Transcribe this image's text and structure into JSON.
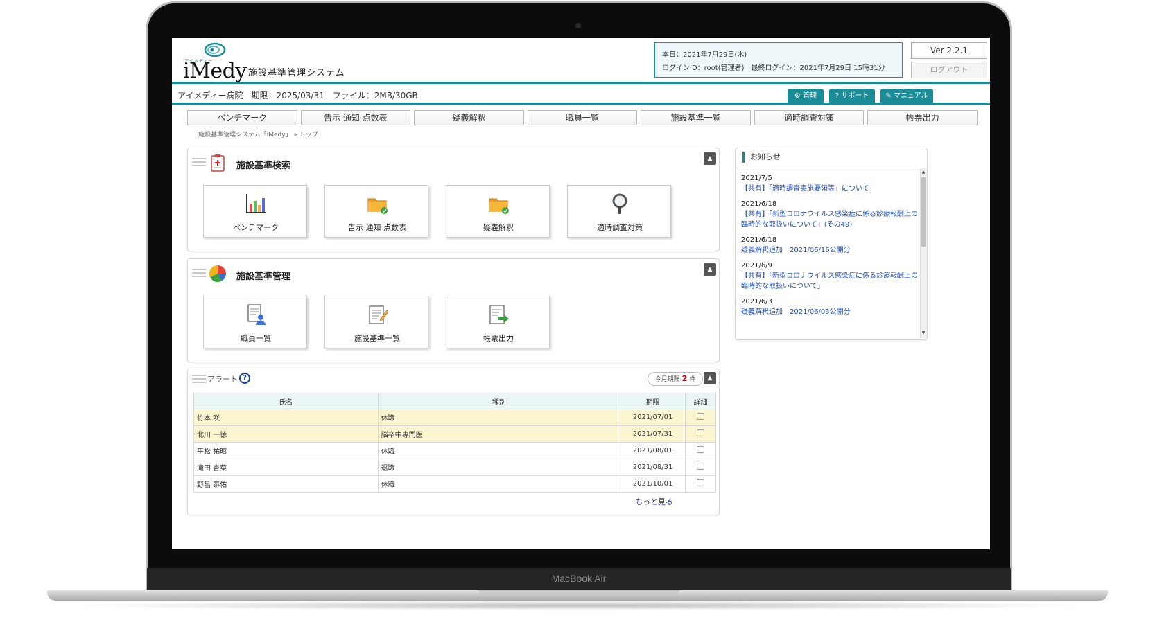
{
  "device": {
    "brand_label": "MacBook Air"
  },
  "header": {
    "logo_ruby": "アイメディー",
    "logo": "iMedy",
    "app_title": "施設基準管理システム",
    "login_date": "本日：2021年7月29日(木)",
    "login_info": "ログインID：root(管理者)　最終ログイン：2021年7月29日 15時31分",
    "version": "Ver 2.2.1",
    "logout": "ログアウト"
  },
  "subbar": {
    "info": "アイメディー病院　期限：2025/03/31　ファイル：2MB/30GB",
    "admin": "管理",
    "support": "サポート",
    "manual": "マニュアル"
  },
  "nav": [
    "ベンチマーク",
    "告示 通知 点数表",
    "疑義解釈",
    "職員一覧",
    "施設基準一覧",
    "適時調査対策",
    "帳票出力"
  ],
  "breadcrumb": "施設基準管理システム「iMedy」 » トップ",
  "search_panel": {
    "title": "施設基準検索",
    "tiles": [
      "ベンチマーク",
      "告示 通知 点数表",
      "疑義解釈",
      "適時調査対策"
    ]
  },
  "manage_panel": {
    "title": "施設基準管理",
    "tiles": [
      "職員一覧",
      "施設基準一覧",
      "帳票出力"
    ]
  },
  "alert_panel": {
    "title": "アラート",
    "help": "?",
    "badge_label": "今月期限",
    "badge_count": "2",
    "badge_unit": "件",
    "columns": [
      "氏名",
      "種別",
      "期限",
      "詳細"
    ],
    "rows": [
      {
        "name": "竹本 咲",
        "type": "休職",
        "due": "2021/07/01"
      },
      {
        "name": "北川 一徳",
        "type": "脳卒中専門医",
        "due": "2021/07/31"
      },
      {
        "name": "平松 祐昭",
        "type": "休職",
        "due": "2021/08/01"
      },
      {
        "name": "滝田 杏菜",
        "type": "退職",
        "due": "2021/08/31"
      },
      {
        "name": "野呂 泰佑",
        "type": "休職",
        "due": "2021/10/01"
      }
    ],
    "more": "もっと見る"
  },
  "news": {
    "title": "お知らせ",
    "items": [
      {
        "date": "2021/7/5",
        "text": "【共有】「適時調査実施要領等」について"
      },
      {
        "date": "2021/6/18",
        "text": "【共有】「新型コロナウイルス感染症に係る診療報酬上の臨時的な取扱いについて」(その49)"
      },
      {
        "date": "2021/6/18",
        "text": "疑義解釈追加　2021/06/16公開分"
      },
      {
        "date": "2021/6/9",
        "text": "【共有】「新型コロナウイルス感染症に係る診療報酬上の臨時的な取扱いについて」"
      },
      {
        "date": "2021/6/3",
        "text": "疑義解釈追加　2021/06/03公開分"
      }
    ]
  },
  "colors": {
    "accent": "#1a8c97",
    "highlight_row": "#fbf6cf",
    "overdue": "#d40000",
    "link": "#2150b8"
  }
}
